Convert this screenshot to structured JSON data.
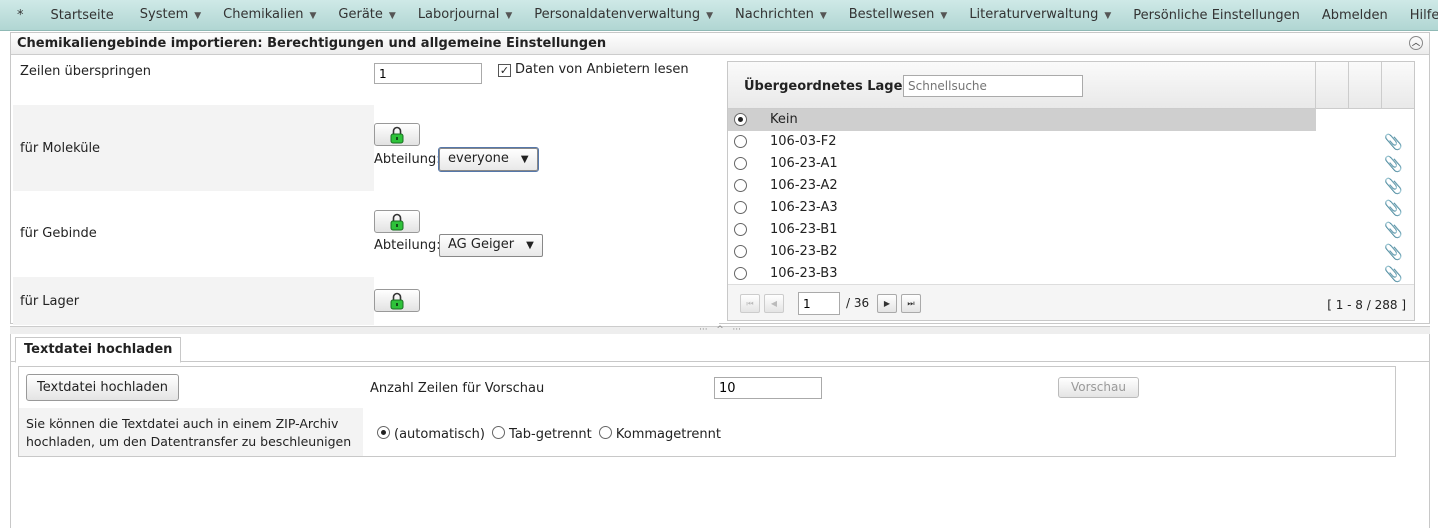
{
  "menu": {
    "star": "*",
    "items": [
      {
        "label": "Startseite",
        "dropdown": false
      },
      {
        "label": "System",
        "dropdown": true
      },
      {
        "label": "Chemikalien",
        "dropdown": true
      },
      {
        "label": "Geräte",
        "dropdown": true
      },
      {
        "label": "Laborjournal",
        "dropdown": true
      },
      {
        "label": "Personaldatenverwaltung",
        "dropdown": true
      },
      {
        "label": "Nachrichten",
        "dropdown": true
      },
      {
        "label": "Bestellwesen",
        "dropdown": true
      },
      {
        "label": "Literaturverwaltung",
        "dropdown": true
      },
      {
        "label": "Persönliche Einstellungen",
        "dropdown": false
      },
      {
        "label": "Abmelden",
        "dropdown": false
      },
      {
        "label": "Hilfe",
        "dropdown": false
      }
    ]
  },
  "panel": {
    "title": "Chemikaliengebinde importieren: Berechtigungen und allgemeine Einstellungen",
    "skip_label": "Zeilen überspringen",
    "skip_value": "1",
    "vendor_label": "Daten von Anbietern lesen",
    "vendor_checked": true,
    "molecules_label": "für Moleküle",
    "containers_label": "für Gebinde",
    "storage_label": "für Lager",
    "dept_label": "Abteilung:",
    "molecules_dept": "everyone",
    "containers_dept": "AG Geiger"
  },
  "storage_grid": {
    "title": "Übergeordnetes Lager",
    "search_placeholder": "Schnellsuche",
    "rows": [
      {
        "name": "Kein",
        "selected": true,
        "attach": false
      },
      {
        "name": "106-03-F2",
        "selected": false,
        "attach": true
      },
      {
        "name": "106-23-A1",
        "selected": false,
        "attach": true
      },
      {
        "name": "106-23-A2",
        "selected": false,
        "attach": true
      },
      {
        "name": "106-23-A3",
        "selected": false,
        "attach": true
      },
      {
        "name": "106-23-B1",
        "selected": false,
        "attach": true
      },
      {
        "name": "106-23-B2",
        "selected": false,
        "attach": true
      },
      {
        "name": "106-23-B3",
        "selected": false,
        "attach": true
      }
    ],
    "page": "1",
    "page_total": "/ 36",
    "range": "[ 1 - 8 / 288 ]"
  },
  "upload": {
    "tab": "Textdatei hochladen",
    "button": "Textdatei hochladen",
    "preview_label": "Anzahl Zeilen für Vorschau",
    "preview_value": "10",
    "preview_button": "Vorschau",
    "zip_hint_1": "Sie können die Textdatei auch in einem ZIP-Archiv",
    "zip_hint_2": "hochladen, um den Datentransfer zu beschleunigen",
    "opt_auto": "(automatisch)",
    "opt_tab": "Tab-getrennt",
    "opt_comma": "Kommagetrennt"
  }
}
